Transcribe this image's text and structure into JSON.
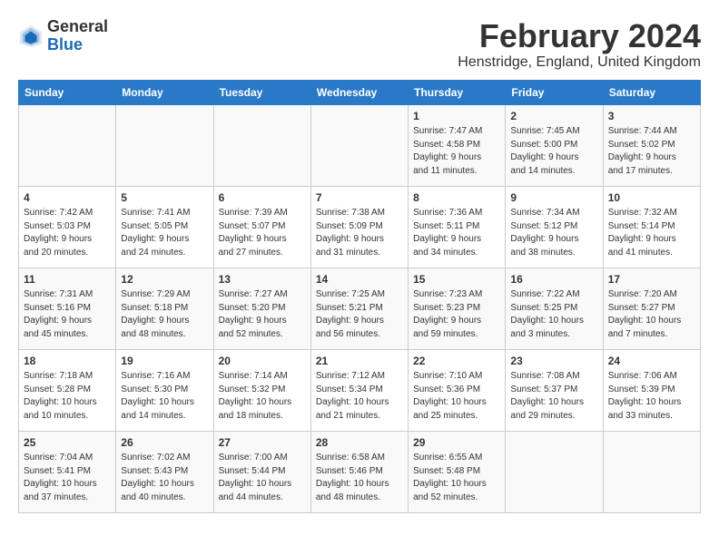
{
  "header": {
    "logo_general": "General",
    "logo_blue": "Blue",
    "month_year": "February 2024",
    "location": "Henstridge, England, United Kingdom"
  },
  "days_of_week": [
    "Sunday",
    "Monday",
    "Tuesday",
    "Wednesday",
    "Thursday",
    "Friday",
    "Saturday"
  ],
  "weeks": [
    [
      {
        "day": "",
        "info": ""
      },
      {
        "day": "",
        "info": ""
      },
      {
        "day": "",
        "info": ""
      },
      {
        "day": "",
        "info": ""
      },
      {
        "day": "1",
        "info": "Sunrise: 7:47 AM\nSunset: 4:58 PM\nDaylight: 9 hours\nand 11 minutes."
      },
      {
        "day": "2",
        "info": "Sunrise: 7:45 AM\nSunset: 5:00 PM\nDaylight: 9 hours\nand 14 minutes."
      },
      {
        "day": "3",
        "info": "Sunrise: 7:44 AM\nSunset: 5:02 PM\nDaylight: 9 hours\nand 17 minutes."
      }
    ],
    [
      {
        "day": "4",
        "info": "Sunrise: 7:42 AM\nSunset: 5:03 PM\nDaylight: 9 hours\nand 20 minutes."
      },
      {
        "day": "5",
        "info": "Sunrise: 7:41 AM\nSunset: 5:05 PM\nDaylight: 9 hours\nand 24 minutes."
      },
      {
        "day": "6",
        "info": "Sunrise: 7:39 AM\nSunset: 5:07 PM\nDaylight: 9 hours\nand 27 minutes."
      },
      {
        "day": "7",
        "info": "Sunrise: 7:38 AM\nSunset: 5:09 PM\nDaylight: 9 hours\nand 31 minutes."
      },
      {
        "day": "8",
        "info": "Sunrise: 7:36 AM\nSunset: 5:11 PM\nDaylight: 9 hours\nand 34 minutes."
      },
      {
        "day": "9",
        "info": "Sunrise: 7:34 AM\nSunset: 5:12 PM\nDaylight: 9 hours\nand 38 minutes."
      },
      {
        "day": "10",
        "info": "Sunrise: 7:32 AM\nSunset: 5:14 PM\nDaylight: 9 hours\nand 41 minutes."
      }
    ],
    [
      {
        "day": "11",
        "info": "Sunrise: 7:31 AM\nSunset: 5:16 PM\nDaylight: 9 hours\nand 45 minutes."
      },
      {
        "day": "12",
        "info": "Sunrise: 7:29 AM\nSunset: 5:18 PM\nDaylight: 9 hours\nand 48 minutes."
      },
      {
        "day": "13",
        "info": "Sunrise: 7:27 AM\nSunset: 5:20 PM\nDaylight: 9 hours\nand 52 minutes."
      },
      {
        "day": "14",
        "info": "Sunrise: 7:25 AM\nSunset: 5:21 PM\nDaylight: 9 hours\nand 56 minutes."
      },
      {
        "day": "15",
        "info": "Sunrise: 7:23 AM\nSunset: 5:23 PM\nDaylight: 9 hours\nand 59 minutes."
      },
      {
        "day": "16",
        "info": "Sunrise: 7:22 AM\nSunset: 5:25 PM\nDaylight: 10 hours\nand 3 minutes."
      },
      {
        "day": "17",
        "info": "Sunrise: 7:20 AM\nSunset: 5:27 PM\nDaylight: 10 hours\nand 7 minutes."
      }
    ],
    [
      {
        "day": "18",
        "info": "Sunrise: 7:18 AM\nSunset: 5:28 PM\nDaylight: 10 hours\nand 10 minutes."
      },
      {
        "day": "19",
        "info": "Sunrise: 7:16 AM\nSunset: 5:30 PM\nDaylight: 10 hours\nand 14 minutes."
      },
      {
        "day": "20",
        "info": "Sunrise: 7:14 AM\nSunset: 5:32 PM\nDaylight: 10 hours\nand 18 minutes."
      },
      {
        "day": "21",
        "info": "Sunrise: 7:12 AM\nSunset: 5:34 PM\nDaylight: 10 hours\nand 21 minutes."
      },
      {
        "day": "22",
        "info": "Sunrise: 7:10 AM\nSunset: 5:36 PM\nDaylight: 10 hours\nand 25 minutes."
      },
      {
        "day": "23",
        "info": "Sunrise: 7:08 AM\nSunset: 5:37 PM\nDaylight: 10 hours\nand 29 minutes."
      },
      {
        "day": "24",
        "info": "Sunrise: 7:06 AM\nSunset: 5:39 PM\nDaylight: 10 hours\nand 33 minutes."
      }
    ],
    [
      {
        "day": "25",
        "info": "Sunrise: 7:04 AM\nSunset: 5:41 PM\nDaylight: 10 hours\nand 37 minutes."
      },
      {
        "day": "26",
        "info": "Sunrise: 7:02 AM\nSunset: 5:43 PM\nDaylight: 10 hours\nand 40 minutes."
      },
      {
        "day": "27",
        "info": "Sunrise: 7:00 AM\nSunset: 5:44 PM\nDaylight: 10 hours\nand 44 minutes."
      },
      {
        "day": "28",
        "info": "Sunrise: 6:58 AM\nSunset: 5:46 PM\nDaylight: 10 hours\nand 48 minutes."
      },
      {
        "day": "29",
        "info": "Sunrise: 6:55 AM\nSunset: 5:48 PM\nDaylight: 10 hours\nand 52 minutes."
      },
      {
        "day": "",
        "info": ""
      },
      {
        "day": "",
        "info": ""
      }
    ]
  ]
}
